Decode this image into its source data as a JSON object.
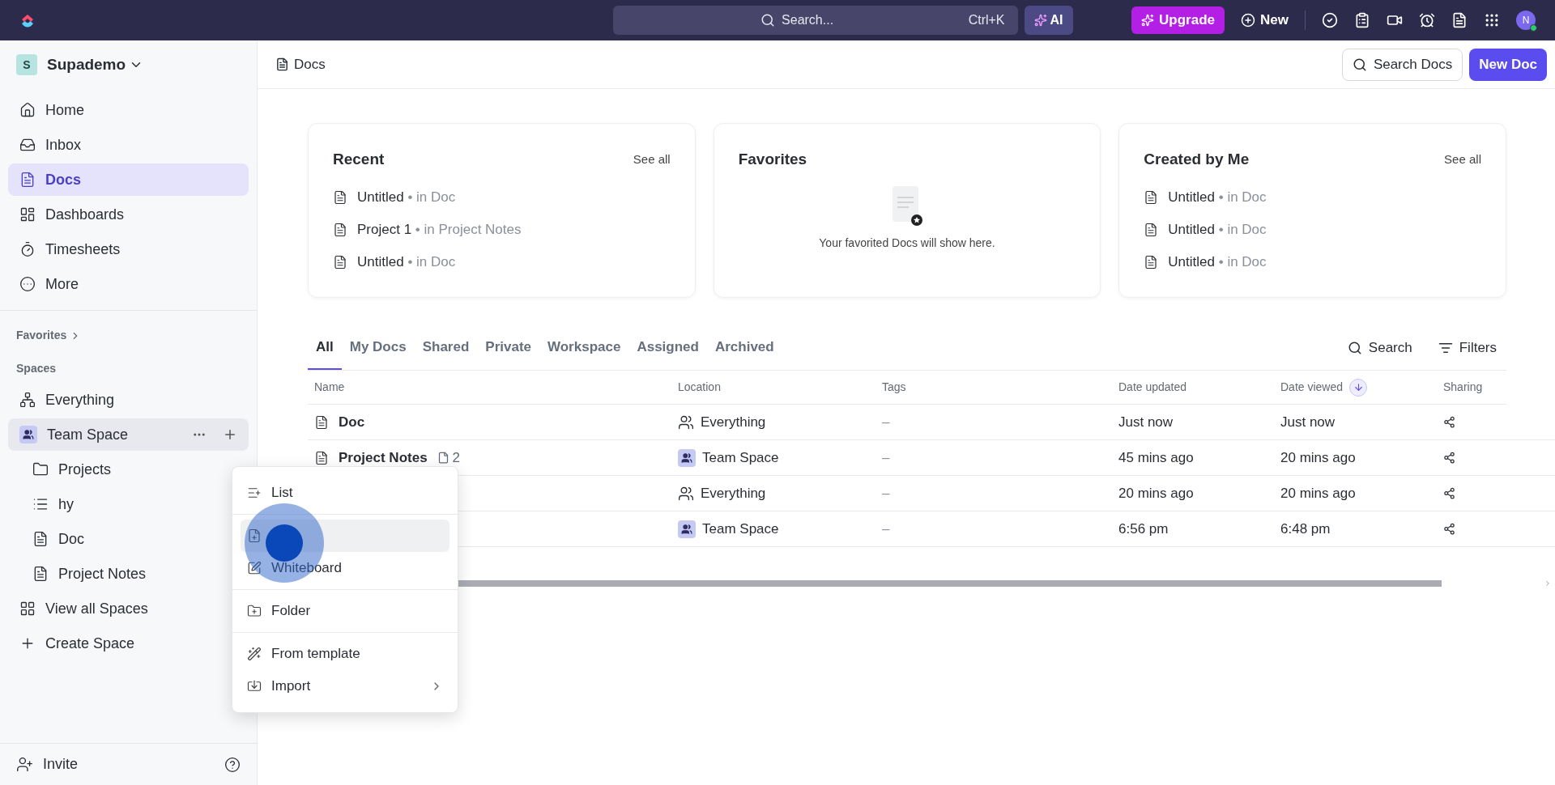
{
  "topbar": {
    "search_placeholder": "Search...",
    "shortcut": "Ctrl+K",
    "ai": "AI",
    "upgrade": "Upgrade",
    "new": "New",
    "avatar": "N"
  },
  "workspace": {
    "initial": "S",
    "name": "Supademo"
  },
  "nav": [
    {
      "kind": "home",
      "label": "Home",
      "selected": false
    },
    {
      "kind": "inbox",
      "label": "Inbox",
      "selected": false
    },
    {
      "kind": "doc",
      "label": "Docs",
      "selected": true
    },
    {
      "kind": "dashboard",
      "label": "Dashboards",
      "selected": false
    },
    {
      "kind": "timer",
      "label": "Timesheets",
      "selected": false
    },
    {
      "kind": "more",
      "label": "More",
      "selected": false
    }
  ],
  "favorites_label": "Favorites",
  "spaces_label": "Spaces",
  "spaces": [
    {
      "kind": "everything",
      "label": "Everything",
      "selected": false
    },
    {
      "kind": "team",
      "label": "Team Space",
      "selected": true,
      "children": [
        {
          "kind": "folder",
          "label": "Projects"
        },
        {
          "kind": "list",
          "label": "hy"
        },
        {
          "kind": "doc",
          "label": "Doc"
        },
        {
          "kind": "doc",
          "label": "Project Notes"
        }
      ]
    },
    {
      "kind": "grid",
      "label": "View all Spaces",
      "selected": false
    },
    {
      "kind": "plus",
      "label": "Create Space",
      "selected": false
    }
  ],
  "invite": "Invite",
  "header": {
    "breadcrumb": "Docs",
    "search_button": "Search Docs",
    "new_button": "New Doc"
  },
  "cards": [
    {
      "title": "Recent",
      "see_all": "See all",
      "items": [
        {
          "name": "Untitled",
          "where": "• in Doc"
        },
        {
          "name": "Project 1",
          "where": "• in Project Notes"
        },
        {
          "name": "Untitled",
          "where": "• in Doc"
        }
      ]
    },
    {
      "title": "Favorites",
      "empty_text": "Your favorited Docs will show here."
    },
    {
      "title": "Created by Me",
      "see_all": "See all",
      "items": [
        {
          "name": "Untitled",
          "where": "• in Doc"
        },
        {
          "name": "Untitled",
          "where": "• in Doc"
        },
        {
          "name": "Untitled",
          "where": "• in Doc"
        }
      ]
    }
  ],
  "tabs": [
    {
      "label": "All",
      "selected": true
    },
    {
      "label": "My Docs",
      "selected": false
    },
    {
      "label": "Shared",
      "selected": false
    },
    {
      "label": "Private",
      "selected": false
    },
    {
      "label": "Workspace",
      "selected": false
    },
    {
      "label": "Assigned",
      "selected": false
    },
    {
      "label": "Archived",
      "selected": false
    }
  ],
  "table_actions": {
    "search": "Search",
    "filters": "Filters"
  },
  "table": {
    "columns": [
      "Name",
      "Location",
      "Tags",
      "Date updated",
      "Date viewed",
      "Sharing"
    ],
    "rows": [
      {
        "name": "Doc",
        "kind": "everything",
        "location": "Everything",
        "tags": "–",
        "updated": "Just now",
        "viewed": "Just now"
      },
      {
        "name": "Project Notes",
        "count": "2",
        "kind": "team",
        "location": "Team Space",
        "tags": "–",
        "updated": "45 mins ago",
        "viewed": "20 mins ago"
      },
      {
        "kind": "everything",
        "location": "Everything",
        "tags": "–",
        "updated": "20 mins ago",
        "viewed": "20 mins ago"
      },
      {
        "kind": "team",
        "location": "Team Space",
        "tags": "–",
        "updated": "6:56 pm",
        "viewed": "6:48 pm"
      }
    ]
  },
  "menu": {
    "groups": [
      [
        {
          "kind": "list",
          "label": "List",
          "selected": false
        }
      ],
      [
        {
          "kind": "doc",
          "selected": true
        },
        {
          "kind": "whiteboard",
          "label": "Whiteboard",
          "selected": false
        }
      ],
      [
        {
          "kind": "folder",
          "label": "Folder",
          "selected": false
        }
      ],
      [
        {
          "kind": "template",
          "label": "From template",
          "selected": false
        },
        {
          "kind": "import",
          "label": "Import",
          "submenu": true,
          "selected": false
        }
      ]
    ]
  }
}
